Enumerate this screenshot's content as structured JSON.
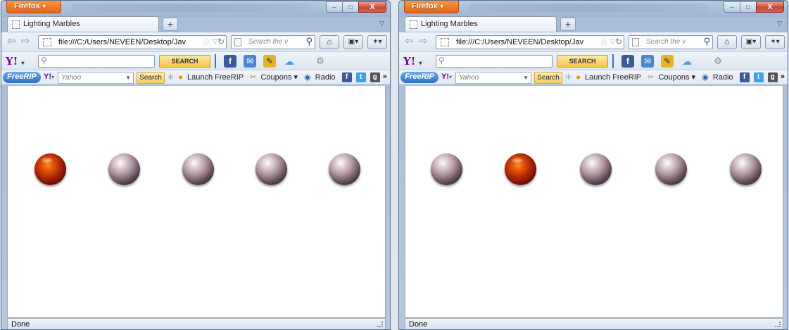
{
  "app": {
    "menu_button": "Firefox",
    "window_controls": {
      "minimize": "–",
      "maximize": "□",
      "close": "X"
    }
  },
  "tab": {
    "title": "Lighting Marbles",
    "new_tab": "+"
  },
  "nav": {
    "url": "file:///C:/Users/NEVEEN/Desktop/Jav",
    "search_placeholder": "Search the v"
  },
  "yahoo_toolbar": {
    "logo": "Y!",
    "search_button": "SEARCH"
  },
  "freerip_toolbar": {
    "logo": "FreeRIP",
    "yahoo_logo": "Y!",
    "search_engine": "Yahoo",
    "search_button": "Search",
    "launch": "Launch FreeRIP",
    "coupons": "Coupons",
    "radio": "Radio",
    "more": "»"
  },
  "status": {
    "text": "Done"
  },
  "colors": {
    "lit_marble": "#c8360a",
    "unlit_marble": "#9c8590",
    "firefox_button": "#e4661b",
    "yahoo_purple": "#7b0099"
  },
  "windows": [
    {
      "lit_index": 0,
      "marble_count": 5
    },
    {
      "lit_index": 1,
      "marble_count": 5
    }
  ]
}
